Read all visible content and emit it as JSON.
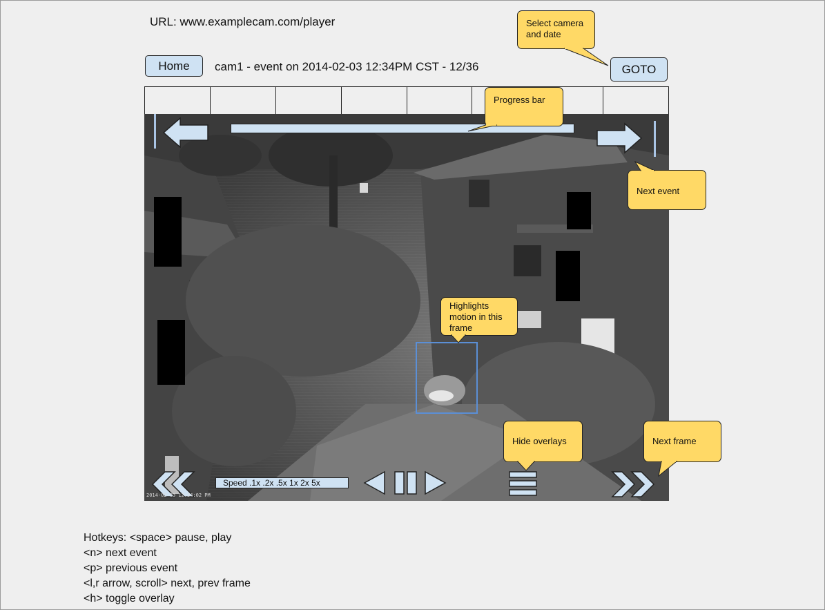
{
  "url_text": "URL: www.examplecam.com/player",
  "header": {
    "home_label": "Home",
    "title": "cam1 - event on 2014-02-03 12:34PM CST - 12/36",
    "goto_label": "GOTO"
  },
  "timeline": {
    "segment_count": 8
  },
  "player": {
    "progress_fraction": 1.0,
    "speed_label": "Speed .1x .2x .5x 1x 2x 5x",
    "timestamp": "2014-02-03 12:34:02 PM"
  },
  "callouts": {
    "select_camera": "Select camera and date",
    "progress_bar": "Progress bar",
    "next_event": "Next event",
    "highlights_motion": "Highlights motion in this frame",
    "hide_overlays": "Hide overlays",
    "next_frame": "Next frame"
  },
  "hotkeys": [
    "Hotkeys: <space> pause, play",
    "<n> next event",
    "<p> previous event",
    "<l,r arrow, scroll> next, prev frame",
    "<h> toggle overlay"
  ],
  "icons": {
    "prev_event": "arrow-left-icon",
    "next_event": "arrow-right-icon",
    "rewind": "double-chevron-left-icon",
    "prev_frame": "triangle-left-icon",
    "pause": "pause-icon",
    "next_frame": "triangle-right-icon",
    "menu": "hamburger-icon",
    "fast_forward": "double-chevron-right-icon"
  },
  "colors": {
    "button_fill": "#cfe2f3",
    "callout_fill": "#ffd966",
    "motion_box": "#5b8fd6"
  }
}
